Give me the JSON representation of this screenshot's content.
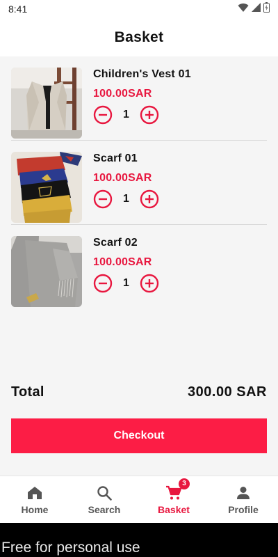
{
  "status_bar": {
    "time": "8:41"
  },
  "header": {
    "title": "Basket"
  },
  "items": [
    {
      "name": "Children's Vest 01",
      "price": "100.00SAR",
      "quantity": "1",
      "image": "vest-photo"
    },
    {
      "name": "Scarf 01",
      "price": "100.00SAR",
      "quantity": "1",
      "image": "scarves-photo"
    },
    {
      "name": "Scarf 02",
      "price": "100.00SAR",
      "quantity": "1",
      "image": "grey-scarf-photo"
    }
  ],
  "summary": {
    "total_label": "Total",
    "total_value": "300.00 SAR"
  },
  "checkout": {
    "label": "Checkout"
  },
  "nav": {
    "home": "Home",
    "search": "Search",
    "basket": "Basket",
    "basket_badge": "3",
    "profile": "Profile"
  },
  "watermark": "Free for personal use",
  "colors": {
    "accent": "#fc1d45",
    "price": "#e8173f",
    "text": "#111111",
    "background": "#f5f5f5"
  }
}
